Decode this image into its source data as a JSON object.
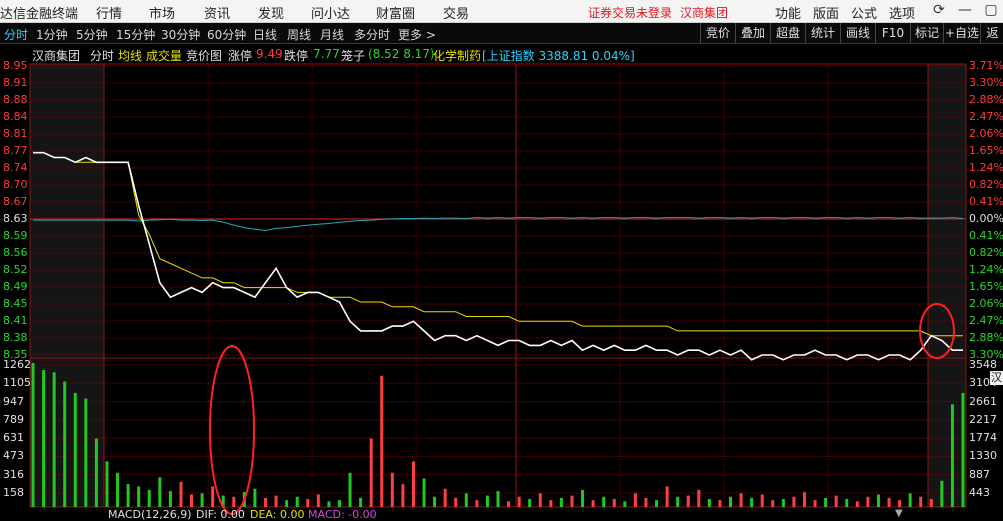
{
  "menubar": {
    "app_title": "达信金融终端",
    "menus": [
      "行情",
      "市场",
      "资讯",
      "发现",
      "问小达",
      "财富圈",
      "交易"
    ],
    "login_status": "证券交易未登录",
    "stock_name": "汉商集团",
    "right_menus": [
      "功能",
      "版面",
      "公式",
      "选项"
    ]
  },
  "periods": [
    "分时",
    "1分钟",
    "5分钟",
    "15分钟",
    "30分钟",
    "60分钟",
    "日线",
    "周线",
    "月线",
    "多分时",
    "更多 >"
  ],
  "right_buttons": [
    "竞价",
    "叠加",
    "超盘",
    "统计",
    "画线",
    "F10",
    "标记",
    "+自选",
    "返回"
  ],
  "info": {
    "name": "汉商集团",
    "mode": "分时",
    "avg_line": "均线",
    "volume": "成交量",
    "auction": "竞价图",
    "limit_up_label": "涨停",
    "limit_up": "9.49",
    "limit_down_label": "跌停",
    "limit_down": "7.77",
    "cage_label": "笼子",
    "cage": "(8.52 8.17)",
    "sector": "化学制药",
    "index": "[上证指数 3388.81 0.04%]"
  },
  "price_axis": [
    "8.95",
    "8.91",
    "8.88",
    "8.84",
    "8.81",
    "8.77",
    "8.74",
    "8.70",
    "8.67",
    "8.63",
    "8.59",
    "8.56",
    "8.52",
    "8.49",
    "8.45",
    "8.41",
    "8.38",
    "8.35"
  ],
  "pct_axis": [
    "3.71%",
    "3.30%",
    "2.88%",
    "2.47%",
    "2.06%",
    "1.65%",
    "1.24%",
    "0.82%",
    "0.41%",
    "0.00%",
    "0.41%",
    "0.82%",
    "1.24%",
    "1.65%",
    "2.06%",
    "2.47%",
    "2.88%",
    "3.30%"
  ],
  "vol_axis_left": [
    "1262",
    "1105",
    "947",
    "789",
    "631",
    "473",
    "316",
    "158"
  ],
  "vol_axis_right": [
    "3548",
    "3104",
    "2661",
    "2217",
    "1774",
    "1330",
    "887",
    "443"
  ],
  "side_tab": "汉",
  "macd": {
    "label": "MACD(12,26,9)",
    "dif": "DIF: 0.00",
    "dea": "DEA: 0.00",
    "macd": "MACD: -0.00"
  },
  "chart_data": {
    "type": "line",
    "price_range": [
      8.35,
      8.95
    ],
    "prev_close": 8.63,
    "price_series": [
      8.77,
      8.77,
      8.76,
      8.76,
      8.75,
      8.76,
      8.75,
      8.75,
      8.75,
      8.75,
      8.66,
      8.58,
      8.5,
      8.47,
      8.48,
      8.49,
      8.48,
      8.5,
      8.49,
      8.49,
      8.48,
      8.47,
      8.5,
      8.53,
      8.49,
      8.47,
      8.48,
      8.48,
      8.47,
      8.46,
      8.42,
      8.4,
      8.4,
      8.4,
      8.41,
      8.41,
      8.42,
      8.4,
      8.38,
      8.39,
      8.39,
      8.38,
      8.39,
      8.38,
      8.37,
      8.38,
      8.38,
      8.37,
      8.37,
      8.38,
      8.37,
      8.38,
      8.36,
      8.37,
      8.36,
      8.37,
      8.36,
      8.36,
      8.37,
      8.36,
      8.36,
      8.35,
      8.36,
      8.36,
      8.35,
      8.36,
      8.35,
      8.36,
      8.34,
      8.35,
      8.35,
      8.34,
      8.35,
      8.35,
      8.36,
      8.35,
      8.35,
      8.34,
      8.35,
      8.35,
      8.34,
      8.35,
      8.35,
      8.34,
      8.36,
      8.39,
      8.38,
      8.36,
      8.36
    ],
    "avg_series": [
      8.77,
      8.77,
      8.76,
      8.76,
      8.75,
      8.75,
      8.75,
      8.75,
      8.75,
      8.75,
      8.64,
      8.6,
      8.55,
      8.54,
      8.53,
      8.52,
      8.51,
      8.51,
      8.5,
      8.5,
      8.49,
      8.49,
      8.49,
      8.49,
      8.49,
      8.48,
      8.48,
      8.48,
      8.47,
      8.47,
      8.47,
      8.46,
      8.46,
      8.46,
      8.45,
      8.45,
      8.45,
      8.44,
      8.44,
      8.44,
      8.44,
      8.43,
      8.43,
      8.43,
      8.43,
      8.43,
      8.42,
      8.42,
      8.42,
      8.42,
      8.42,
      8.42,
      8.41,
      8.41,
      8.41,
      8.41,
      8.41,
      8.41,
      8.41,
      8.41,
      8.41,
      8.4,
      8.4,
      8.4,
      8.4,
      8.4,
      8.4,
      8.4,
      8.4,
      8.4,
      8.4,
      8.4,
      8.4,
      8.4,
      8.4,
      8.4,
      8.4,
      8.4,
      8.4,
      8.4,
      8.4,
      8.4,
      8.4,
      8.4,
      8.4,
      8.39,
      8.39,
      8.39,
      8.39
    ],
    "index_pct_series": [
      0.0,
      0.0,
      0.0,
      0.0,
      0.0,
      0.0,
      0.0,
      0.0,
      0.0,
      0.0,
      -0.02,
      0.0,
      0.01,
      0.02,
      0.0,
      0.0,
      -0.01,
      0.0,
      -0.05,
      -0.12,
      -0.18,
      -0.22,
      -0.25,
      -0.2,
      -0.18,
      -0.15,
      -0.12,
      -0.1,
      -0.08,
      -0.05,
      -0.03,
      -0.01,
      0.0,
      0.02,
      0.03,
      0.04,
      0.04,
      0.05,
      0.04,
      0.05,
      0.05,
      0.04,
      0.06,
      0.05,
      0.06,
      0.05,
      0.06,
      0.06,
      0.05,
      0.06,
      0.06,
      0.05,
      0.06,
      0.05,
      0.06,
      0.06,
      0.05,
      0.06,
      0.06,
      0.05,
      0.06,
      0.06,
      0.06,
      0.05,
      0.06,
      0.06,
      0.05,
      0.06,
      0.05,
      0.06,
      0.06,
      0.05,
      0.06,
      0.06,
      0.05,
      0.06,
      0.06,
      0.05,
      0.06,
      0.05,
      0.06,
      0.06,
      0.05,
      0.06,
      0.05,
      0.05,
      0.05,
      0.06,
      0.04
    ],
    "volume_max": 1262,
    "volume_series": [
      1262,
      1200,
      1180,
      1100,
      1000,
      950,
      600,
      400,
      300,
      200,
      180,
      150,
      260,
      140,
      220,
      110,
      120,
      180,
      100,
      90,
      130,
      160,
      80,
      100,
      60,
      90,
      70,
      110,
      50,
      60,
      300,
      80,
      600,
      1150,
      300,
      200,
      400,
      250,
      90,
      160,
      80,
      120,
      60,
      100,
      140,
      50,
      90,
      70,
      120,
      60,
      80,
      100,
      150,
      60,
      90,
      70,
      50,
      120,
      80,
      60,
      180,
      90,
      100,
      150,
      70,
      60,
      90,
      120,
      80,
      110,
      60,
      70,
      90,
      130,
      60,
      80,
      100,
      70,
      50,
      90,
      110,
      80,
      60,
      120,
      90,
      70,
      230,
      900,
      1000
    ]
  }
}
